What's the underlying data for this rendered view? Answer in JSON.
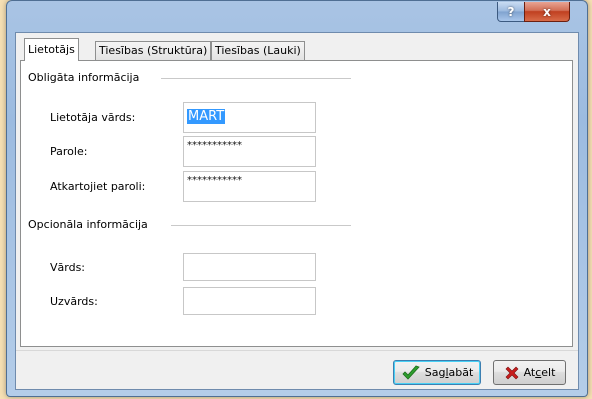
{
  "window": {
    "help_glyph": "?",
    "close_glyph": "x"
  },
  "tabs": [
    {
      "label": "Lietotājs",
      "active": true
    },
    {
      "label": "Tiesības (Struktūra)",
      "active": false
    },
    {
      "label": "Tiesības (Lauki)",
      "active": false
    }
  ],
  "required_section": {
    "title": "Obligāta informācija",
    "fields": [
      {
        "label": "Lietotāja vārds:",
        "value": "MART"
      },
      {
        "label": "Parole:",
        "value": "***********"
      },
      {
        "label": "Atkartojiet paroli:",
        "value": "***********"
      }
    ]
  },
  "optional_section": {
    "title": "Opcionāla informācija",
    "fields": [
      {
        "label": "Vārds:",
        "value": ""
      },
      {
        "label": "Uzvārds:",
        "value": ""
      }
    ]
  },
  "buttons": {
    "save": {
      "pre": "Sag",
      "accel": "l",
      "post": "abāt"
    },
    "cancel": {
      "pre": "At",
      "accel": "c",
      "post": "elt"
    }
  },
  "colors": {
    "accent_selection": "#3399ff",
    "save_icon": "#2e9e2e",
    "cancel_icon": "#c81e1e",
    "background": "#f6e0b4"
  }
}
